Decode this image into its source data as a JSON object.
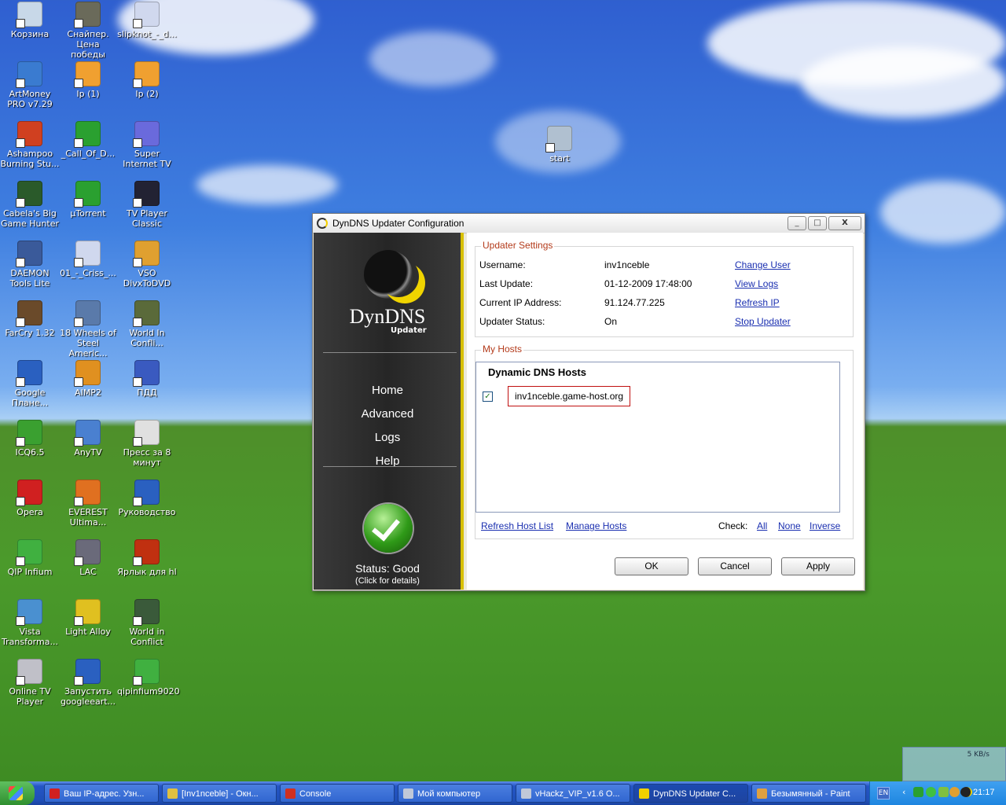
{
  "desktop": {
    "icons": [
      {
        "label": "Корзина",
        "color": "#c8d8e8"
      },
      {
        "label": "Снайпер. Цена победы",
        "color": "#6a6a5a"
      },
      {
        "label": "slipknot_-_d...",
        "color": "#d0d8ee"
      },
      {
        "label": "ArtMoney PRO v7.29",
        "color": "#3a7bd0"
      },
      {
        "label": "Ip (1)",
        "color": "#f0a030"
      },
      {
        "label": "Ip (2)",
        "color": "#f0a030"
      },
      {
        "label": "Ashampoo Burning Stu...",
        "color": "#d04020"
      },
      {
        "label": "_Call_Of_D...",
        "color": "#2aa030"
      },
      {
        "label": "Super Internet TV",
        "color": "#6a6adc"
      },
      {
        "label": "Cabela's Big Game Hunter",
        "color": "#2a5a2a"
      },
      {
        "label": "µTorrent",
        "color": "#2aa030"
      },
      {
        "label": "TV Player Classic",
        "color": "#223"
      },
      {
        "label": "DAEMON Tools Lite",
        "color": "#3a5a9a"
      },
      {
        "label": "01_-_Criss_...",
        "color": "#d0d8ee"
      },
      {
        "label": "VSO DivxToDVD",
        "color": "#e0a030"
      },
      {
        "label": "FarCry 1.32",
        "color": "#6a4a2a"
      },
      {
        "label": "18 Wheels of Steel Americ...",
        "color": "#5a7aaa"
      },
      {
        "label": "World In Confli...",
        "color": "#5a6a3a"
      },
      {
        "label": "Google Плане...",
        "color": "#2a60c0"
      },
      {
        "label": "AIMP2",
        "color": "#e09020"
      },
      {
        "label": "ПДД",
        "color": "#3a5ac0"
      },
      {
        "label": "ICQ6.5",
        "color": "#3aa030"
      },
      {
        "label": "AnyTV",
        "color": "#4a80d0"
      },
      {
        "label": "Пресс за 8 минут",
        "color": "#e0e0e0"
      },
      {
        "label": "Opera",
        "color": "#d02020"
      },
      {
        "label": "EVEREST Ultima...",
        "color": "#e07020"
      },
      {
        "label": "Руководство",
        "color": "#2a60c0"
      },
      {
        "label": "QIP Infium",
        "color": "#40b040"
      },
      {
        "label": "LAC",
        "color": "#6a6a7a"
      },
      {
        "label": "Ярлык для hl",
        "color": "#c03010"
      },
      {
        "label": "Vista Transforma...",
        "color": "#4a90d0"
      },
      {
        "label": "Light Alloy",
        "color": "#e0c020"
      },
      {
        "label": "World in Conflict",
        "color": "#3a5a3a"
      },
      {
        "label": "Online TV Player",
        "color": "#c0c0c8"
      },
      {
        "label": "Запустить googleeart...",
        "color": "#2a60c0"
      },
      {
        "label": "qipinfium9020",
        "color": "#40b040"
      },
      {
        "label": "start",
        "color": "#b0c0d0"
      }
    ]
  },
  "window": {
    "title": "DynDNS Updater Configuration",
    "min_symbol": "_",
    "max_symbol": "□",
    "close_symbol": "X",
    "sidebar": {
      "brand": "DynDNS",
      "brand_sub": "Updater",
      "nav": [
        "Home",
        "Advanced",
        "Logs",
        "Help"
      ],
      "status": "Status: Good",
      "status_sub": "(Click for details)"
    },
    "updater_settings": {
      "legend": "Updater Settings",
      "rows": [
        {
          "label": "Username:",
          "value": "inv1nceble",
          "action": "Change User"
        },
        {
          "label": "Last Update:",
          "value": "01-12-2009 17:48:00",
          "action": "View Logs"
        },
        {
          "label": "Current IP Address:",
          "value": "91.124.77.225",
          "action": "Refresh IP"
        },
        {
          "label": "Updater Status:",
          "value": "On",
          "action": "Stop Updater"
        }
      ]
    },
    "my_hosts": {
      "legend": "My Hosts",
      "list_header": "Dynamic DNS Hosts",
      "host": "inv1nceble.game-host.org",
      "host_checked": true,
      "check_mark": "✓",
      "refresh_link": "Refresh Host List",
      "manage_link": "Manage Hosts",
      "check_label": "Check:",
      "check_all": "All",
      "check_none": "None",
      "check_inverse": "Inverse"
    },
    "buttons": {
      "ok": "OK",
      "cancel": "Cancel",
      "apply": "Apply"
    }
  },
  "taskbar": {
    "tasks": [
      {
        "label": "Ваш IP-адрес. Узн...",
        "color": "#d02020"
      },
      {
        "label": "[Inv1nceble] - Окн...",
        "color": "#e0c040"
      },
      {
        "label": "Console",
        "color": "#d03020"
      },
      {
        "label": "Мой компьютер",
        "color": "#c0c8d8"
      },
      {
        "label": "vHackz_VIP_v1.6 O...",
        "color": "#c0c8d8"
      },
      {
        "label": "DynDNS Updater C...",
        "color": "#f0d000"
      },
      {
        "label": "Безымянный - Paint",
        "color": "#e0a040"
      }
    ],
    "lang": "EN",
    "clock": "21:17",
    "netmon": "5 KB/s"
  }
}
